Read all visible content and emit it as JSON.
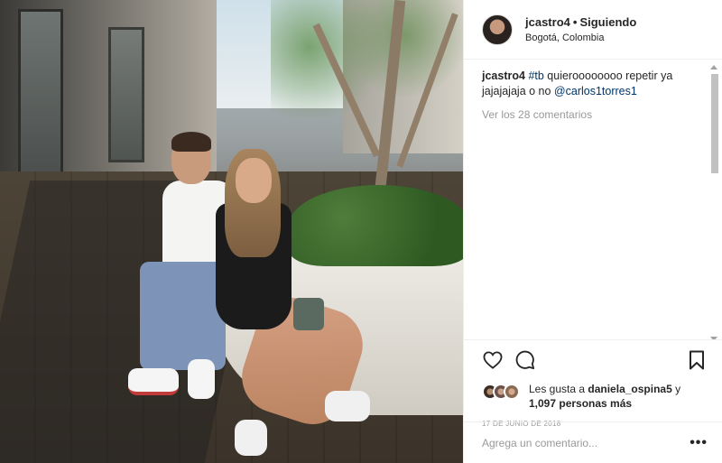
{
  "header": {
    "username": "jcastro4",
    "separator": "•",
    "follow_status": "Siguiendo",
    "location": "Bogotá, Colombia"
  },
  "caption": {
    "username": "jcastro4",
    "hashtag": "#tb",
    "text": " quieroooooooo repetir ya jajajajaja o no ",
    "mention": "@carlos1torres1"
  },
  "view_all_comments": "Ver los 28 comentarios",
  "likes": {
    "prefix": "Les gusta a ",
    "user": "daniela_ospina5",
    "middle": " y ",
    "others": "1,097 personas más"
  },
  "date": "17 DE JUNIO DE 2018",
  "comment_box": {
    "placeholder": "Agrega un comentario...",
    "more_label": "•••"
  },
  "icons": {
    "like": "heart-icon",
    "comment": "comment-bubble-icon",
    "save": "bookmark-icon"
  }
}
